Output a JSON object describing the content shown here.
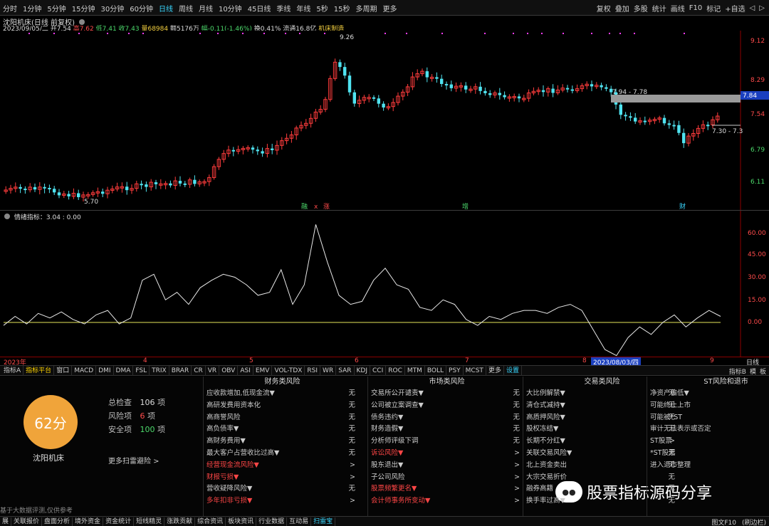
{
  "toolbar": {
    "periods": [
      "分时",
      "1分钟",
      "5分钟",
      "15分钟",
      "30分钟",
      "60分钟",
      "日线",
      "周线",
      "月线",
      "10分钟",
      "45日线",
      "季线",
      "年线",
      "5秒",
      "15秒",
      "多周期",
      "更多"
    ],
    "active_period": "日线",
    "right_tools": [
      "复权",
      "叠加",
      "多股",
      "统计",
      "画线",
      "F10",
      "标记",
      "+自选",
      "◁",
      "▷"
    ]
  },
  "stock": {
    "name": "沈阳机床(日线 前复权)",
    "date": "2023/09/05/二",
    "open": "开7.54",
    "high": "高7.62",
    "low": "低7.41",
    "close": "收7.43",
    "volume": "量68984",
    "amount": "额5176万",
    "change": "幅-0.11(-1.46%)",
    "turnover": "换0.41%",
    "float_cap": "流通16.8亿",
    "industry": "机床制造"
  },
  "main_axis": {
    "ticks": [
      "9.12",
      "8.29",
      "7.54",
      "6.79",
      "6.11"
    ],
    "current_price": "7.84"
  },
  "main_labels": {
    "high": "9.26",
    "low": "5.70",
    "range1": "7.94 - 7.78",
    "range2": "7.30 - 7.3"
  },
  "event_markers": [
    "融",
    "x",
    "涨",
    "增",
    "财"
  ],
  "indicator": {
    "label": "情绪指标：3.04 : 0.00",
    "ticks": [
      "60.00",
      "45.00",
      "30.00",
      "15.00",
      "0.00"
    ]
  },
  "date_axis": [
    "2023年",
    "4",
    "5",
    "6",
    "7",
    "8",
    "9"
  ],
  "date_badge": "2023/08/03/四",
  "timeframe": "日线",
  "chart_data": {
    "type": "line",
    "x": [
      "2023-03",
      "2023-04",
      "2023-05",
      "2023-06",
      "2023-07",
      "2023-08",
      "2023-09"
    ],
    "series": [
      {
        "name": "情绪指标",
        "values": [
          -2,
          4,
          -1,
          6,
          3,
          7,
          2,
          -1,
          5,
          8,
          -1,
          3,
          28,
          32,
          15,
          20,
          12,
          23,
          28,
          32,
          30,
          25,
          18,
          20,
          35,
          12,
          25,
          65,
          40,
          18,
          12,
          14,
          28,
          36,
          25,
          22,
          10,
          8,
          15,
          12,
          2,
          -2,
          4,
          2,
          6,
          8,
          8,
          6,
          10,
          12,
          8,
          -5,
          -18,
          -22,
          -10,
          -3,
          -8,
          0,
          5,
          -3,
          3,
          8,
          4
        ]
      }
    ],
    "ylim": [
      -25,
      70
    ]
  },
  "tabs": [
    "指标A",
    "指标平台",
    "窗口",
    "MACD",
    "DMI",
    "DMA",
    "FSL",
    "TRIX",
    "BRAR",
    "CR",
    "VR",
    "OBV",
    "ASI",
    "EMV",
    "VOL-TDX",
    "RSI",
    "WR",
    "SAR",
    "KDJ",
    "CCI",
    "ROC",
    "MTM",
    "BOLL",
    "PSY",
    "MCST",
    "更多",
    "设置"
  ],
  "tab_right": [
    "指标B",
    "模",
    "板"
  ],
  "risk": {
    "score": "62分",
    "name": "沈阳机床",
    "stats": [
      {
        "label": "总检查",
        "value": "106",
        "unit": "项"
      },
      {
        "label": "风险项",
        "value": "6",
        "unit": "项"
      },
      {
        "label": "安全项",
        "value": "100",
        "unit": "项"
      }
    ],
    "more": "更多扫雷避险 >",
    "disclaimer": "基于大数据评测,仅供参考",
    "columns": [
      {
        "title": "财务类风险",
        "items": [
          {
            "label": "应收款增加,低现金流▼",
            "status": "无",
            "red": false
          },
          {
            "label": "高研发费用资本化",
            "status": "无",
            "red": false
          },
          {
            "label": "高商誉风险",
            "status": "无",
            "red": false
          },
          {
            "label": "高负债率▼",
            "status": "无",
            "red": false
          },
          {
            "label": "高财务费用▼",
            "status": "无",
            "red": false
          },
          {
            "label": "最大客户占营收比过高▼",
            "status": "无",
            "red": false
          },
          {
            "label": "经营现金流风险▼",
            "status": ">",
            "red": true
          },
          {
            "label": "财报亏损▼",
            "status": ">",
            "red": true
          },
          {
            "label": "营收疑降风险▼",
            "status": "无",
            "red": false
          },
          {
            "label": "多年扣非亏损▼",
            "status": ">",
            "red": true
          }
        ]
      },
      {
        "title": "市场类风险",
        "items": [
          {
            "label": "交易所公开谴责▼",
            "status": "无",
            "red": false
          },
          {
            "label": "公司被立案调查▼",
            "status": "无",
            "red": false
          },
          {
            "label": "债务违约▼",
            "status": "无",
            "red": false
          },
          {
            "label": "财务造假▼",
            "status": "无",
            "red": false
          },
          {
            "label": "分析师评级下调",
            "status": "无",
            "red": false
          },
          {
            "label": "诉讼风险▼",
            "status": ">",
            "red": true
          },
          {
            "label": "股东退出▼",
            "status": ">",
            "red": false
          },
          {
            "label": "子公司风险",
            "status": ">",
            "red": false
          },
          {
            "label": "股票频繁更名▼",
            "status": ">",
            "red": true
          },
          {
            "label": "会计师事务所变动▼",
            "status": ">",
            "red": true
          }
        ]
      },
      {
        "title": "交易类风险",
        "items": [
          {
            "label": "大比例解禁▼",
            "status": "无",
            "red": false
          },
          {
            "label": "清仓式减持▼",
            "status": "无",
            "red": false
          },
          {
            "label": "高质押风险▼",
            "status": "无",
            "red": false
          },
          {
            "label": "股权冻结▼",
            "status": "无",
            "red": false
          },
          {
            "label": "长期不分红▼",
            "status": ">",
            "red": false
          },
          {
            "label": "关联交易风险▼",
            "status": "无",
            "red": false
          },
          {
            "label": "北上资金卖出",
            "status": "无",
            "red": false
          },
          {
            "label": "大宗交易折价",
            "status": "无",
            "red": false
          },
          {
            "label": "融券高籍",
            "status": "无",
            "red": false
          },
          {
            "label": "换手率过高▼",
            "status": "无",
            "red": false
          }
        ]
      },
      {
        "title": "ST风险和退市",
        "items": [
          {
            "label": "净资产偏低▼",
            "status": "无",
            "red": false
          },
          {
            "label": "可能终止上市",
            "status": "无",
            "red": false
          },
          {
            "label": "可能被*ST",
            "status": "无",
            "red": false
          },
          {
            "label": "审计无法表示或否定",
            "status": "无",
            "red": false
          },
          {
            "label": "ST股票",
            "status": "无",
            "red": false
          },
          {
            "label": "*ST股票",
            "status": "无",
            "red": false
          },
          {
            "label": "进入退市整理",
            "status": "无",
            "red": false
          }
        ]
      }
    ]
  },
  "watermark": {
    "text": "股票指标源码分享"
  },
  "bottom_tabs": [
    "展",
    "关联报价",
    "盘面分析",
    "境外资金",
    "资金统计",
    "短线精灵",
    "涨跌贡献",
    "综合资讯",
    "板块资讯",
    "行业数据",
    "互动易",
    "扫雷宝"
  ],
  "bottom_right": [
    "图文F10",
    "(刷边栏)"
  ],
  "colors": {
    "up": "#ff3c3c",
    "down": "#4fe3f0",
    "accent": "#39d7ff",
    "score": "#f0a43a"
  }
}
